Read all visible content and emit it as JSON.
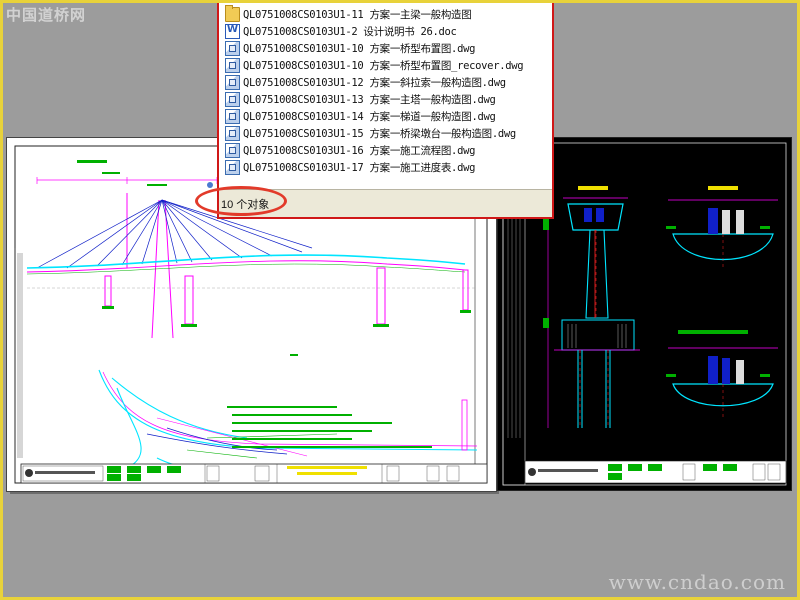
{
  "watermark": {
    "top": "中国道桥网",
    "bottom": "www.cndao.com"
  },
  "file_list": {
    "items": [
      {
        "icon": "folder-icon",
        "name": "QL0751008CS0103U1-11 方案一主梁一般构造图"
      },
      {
        "icon": "word-document-icon",
        "name": "QL0751008CS0103U1-2 设计说明书 26.doc"
      },
      {
        "icon": "dwg-file-icon",
        "name": "QL0751008CS0103U1-10 方案一桥型布置图.dwg"
      },
      {
        "icon": "dwg-file-icon",
        "name": "QL0751008CS0103U1-10 方案一桥型布置图_recover.dwg"
      },
      {
        "icon": "dwg-file-icon",
        "name": "QL0751008CS0103U1-12 方案一斜拉索一般构造图.dwg"
      },
      {
        "icon": "dwg-file-icon",
        "name": "QL0751008CS0103U1-13 方案一主塔一般构造图.dwg"
      },
      {
        "icon": "dwg-file-icon",
        "name": "QL0751008CS0103U1-14 方案一梯道一般构造图.dwg"
      },
      {
        "icon": "dwg-file-icon",
        "name": "QL0751008CS0103U1-15 方案一桥梁墩台一般构造图.dwg"
      },
      {
        "icon": "dwg-file-icon",
        "name": "QL0751008CS0103U1-16 方案一施工流程图.dwg"
      },
      {
        "icon": "dwg-file-icon",
        "name": "QL0751008CS0103U1-17 方案一施工进度表.dwg"
      }
    ]
  },
  "status_bar": {
    "text": "10 个对象"
  },
  "colors": {
    "highlight": "#e23a2a",
    "window_border": "#d01818",
    "cad_cyan": "#00e5ff",
    "cad_magenta": "#ff00ff",
    "cad_blue": "#1020c8",
    "cad_green": "#00b000"
  }
}
